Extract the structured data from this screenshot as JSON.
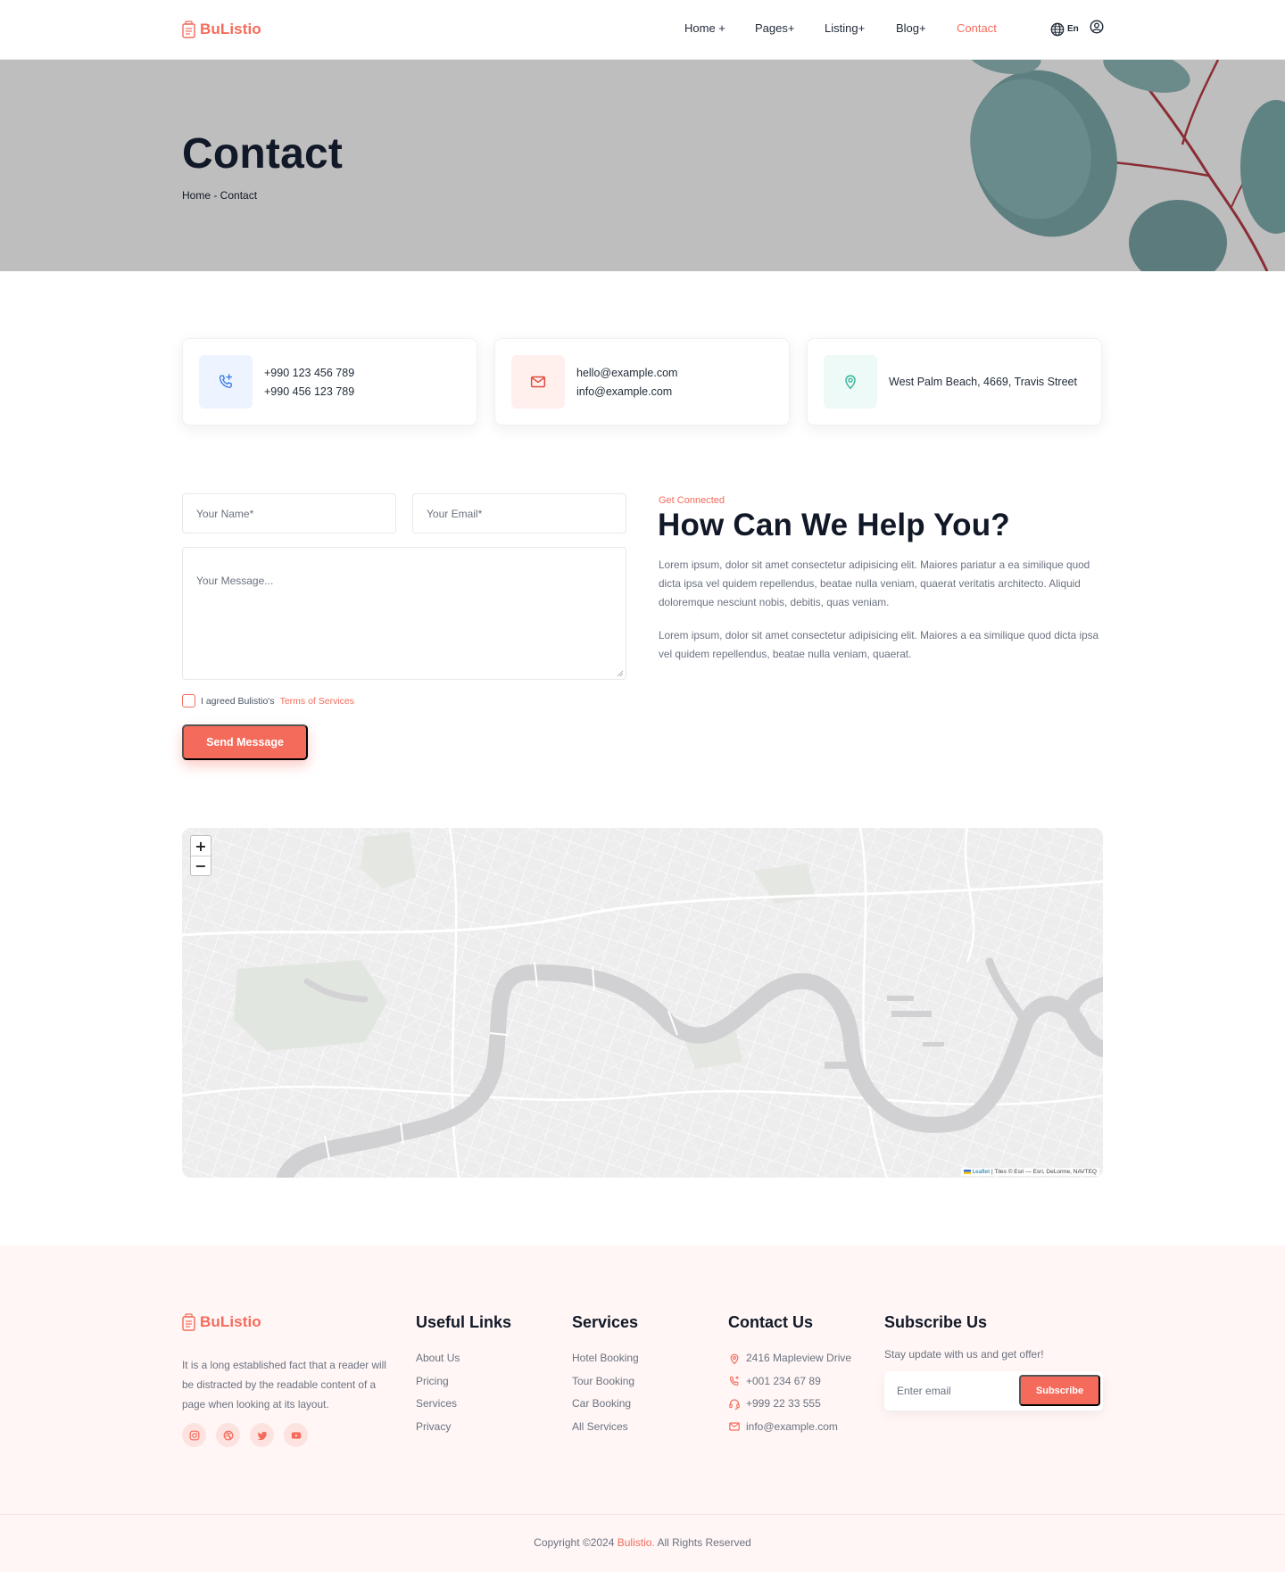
{
  "header": {
    "logo_text": "BuListio",
    "nav": [
      "Home +",
      "Pages+",
      "Listing+",
      "Blog+",
      "Contact"
    ],
    "active_nav": "Contact",
    "language": "En"
  },
  "hero": {
    "title": "Contact",
    "breadcrumb": "Home - Contact"
  },
  "contact_cards": [
    {
      "icon": "phone-icon",
      "lines": [
        "+990 123 456 789",
        "+990 456 123 789"
      ]
    },
    {
      "icon": "mail-icon",
      "lines": [
        "hello@example.com",
        "info@example.com"
      ]
    },
    {
      "icon": "location-icon",
      "lines": [
        "West Palm Beach, 4669, Travis Street"
      ]
    }
  ],
  "form": {
    "name_placeholder": "Your Name*",
    "email_placeholder": "Your Email*",
    "message_placeholder": "Your Message...",
    "agree_text": "I agreed Bulistio's",
    "terms_text": "Terms of Services",
    "submit_label": "Send Message"
  },
  "help": {
    "eyebrow": "Get Connected",
    "title": "How Can We Help You?",
    "paragraph_1": "Lorem ipsum, dolor sit amet consectetur adipisicing elit. Maiores pariatur a ea similique quod dicta ipsa vel quidem repellendus, beatae nulla veniam, quaerat veritatis architecto. Aliquid doloremque nesciunt nobis, debitis, quas veniam.",
    "paragraph_2": "Lorem ipsum, dolor sit amet consectetur adipisicing elit. Maiores a ea similique quod dicta ipsa vel quidem repellendus, beatae nulla veniam, quaerat."
  },
  "map": {
    "zoom_in": "+",
    "zoom_out": "−",
    "attribution_link": "Leaflet",
    "attribution_text": "| Tiles © Esri — Esri, DeLorme, NAVTEQ"
  },
  "footer": {
    "logo_text": "BuListio",
    "about": "It is a long established fact that a reader will be distracted by the readable content of a page when looking at its layout.",
    "socials": [
      "instagram-icon",
      "dribbble-icon",
      "twitter-icon",
      "youtube-icon"
    ],
    "useful_links_title": "Useful Links",
    "useful_links": [
      "About Us",
      "Pricing",
      "Services",
      "Privacy"
    ],
    "services_title": "Services",
    "services": [
      "Hotel Booking",
      "Tour Booking",
      "Car Booking",
      "All Services"
    ],
    "contact_title": "Contact Us",
    "contact": [
      {
        "icon": "location-icon",
        "text": "2416 Mapleview Drive"
      },
      {
        "icon": "phone-icon",
        "text": "+001 234 67 89"
      },
      {
        "icon": "headset-icon",
        "text": "+999 22 33 555"
      },
      {
        "icon": "mail-icon",
        "text": "info@example.com"
      }
    ],
    "subscribe_title": "Subscribe Us",
    "subscribe_text": "Stay update with us and get offer!",
    "email_placeholder": "Enter email",
    "subscribe_label": "Subscribe",
    "copyright_prefix": "Copyright ©2024",
    "copyright_brand": "Bulistio.",
    "copyright_suffix": "All Rights Reserved"
  },
  "colors": {
    "accent": "#f56b5b",
    "text_dark": "#111827",
    "text_muted": "#6b7280",
    "footer_bg": "#fff6f5",
    "hero_bg": "#bebebe",
    "phone_icon_bg": "#eef4ff",
    "mail_icon_bg": "#fff0ee",
    "location_icon_bg": "#eefaf7"
  }
}
